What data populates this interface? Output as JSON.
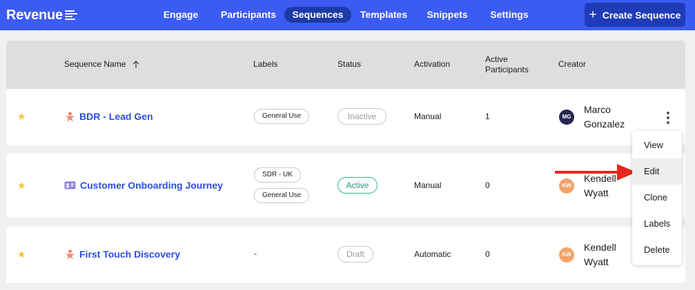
{
  "brand": {
    "name": "Revenue"
  },
  "nav": {
    "items": [
      {
        "label": "Engage"
      },
      {
        "label": "Participants"
      },
      {
        "label": "Sequences"
      },
      {
        "label": "Templates"
      },
      {
        "label": "Snippets"
      },
      {
        "label": "Settings"
      }
    ],
    "active": "Sequences",
    "create_button": "Create Sequence"
  },
  "table": {
    "columns": {
      "name": "Sequence Name",
      "labels": "Labels",
      "status": "Status",
      "activation": "Activation",
      "participants_line1": "Active",
      "participants_line2": "Participants",
      "creator": "Creator"
    },
    "sort_icon": "arrow-up-icon",
    "rows": [
      {
        "starred": true,
        "icon": "person-icon",
        "name": "BDR - Lead Gen",
        "labels": [
          "General Use"
        ],
        "status": "Inactive",
        "activation": "Manual",
        "participants": "1",
        "creator_initials": "MG",
        "creator_first": "Marco",
        "creator_last": "Gonzalez"
      },
      {
        "starred": true,
        "icon": "id-card-icon",
        "name": "Customer Onboarding Journey",
        "labels": [
          "SDR - UK",
          "General Use"
        ],
        "status": "Active",
        "activation": "Manual",
        "participants": "0",
        "creator_initials": "KW",
        "creator_first": "Kendell",
        "creator_last": "Wyatt"
      },
      {
        "starred": true,
        "icon": "person-icon",
        "name": "First Touch Discovery",
        "labels_text": "-",
        "status": "Draft",
        "activation": "Automatic",
        "participants": "0",
        "creator_initials": "KW",
        "creator_first": "Kendell",
        "creator_last": "Wyatt"
      }
    ]
  },
  "row_menu": {
    "items": [
      {
        "label": "View"
      },
      {
        "label": "Edit"
      },
      {
        "label": "Clone"
      },
      {
        "label": "Labels"
      },
      {
        "label": "Delete"
      }
    ],
    "highlighted": "Edit"
  },
  "colors": {
    "nav_bg": "#3c5bf2",
    "nav_active": "#1e3aa8",
    "link": "#2b4ee0",
    "star": "#f4c430",
    "active_status": "#2fb58e",
    "arrow": "#e8281e"
  }
}
